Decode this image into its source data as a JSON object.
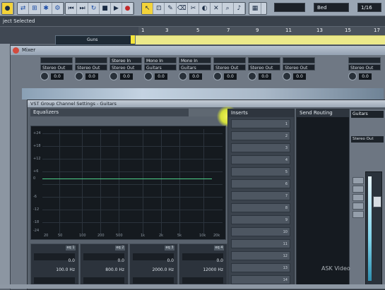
{
  "toolbar": {
    "fields": [
      "",
      "Bed",
      "1/16"
    ],
    "icons": [
      "arrow-icon",
      "range-icon",
      "pencil-icon",
      "eraser-icon",
      "scissors-icon",
      "glue-icon",
      "mute-icon",
      "zoom-icon",
      "line-icon",
      "play-icon",
      "speaker-icon",
      "color-icon"
    ]
  },
  "project": {
    "info_line": "ject Selected",
    "track_name": "Guns",
    "ruler": [
      "1",
      "3",
      "5",
      "7",
      "9",
      "11",
      "13",
      "15",
      "17"
    ]
  },
  "mixer": {
    "title": "Mixer",
    "strips": [
      {
        "name": "",
        "route": "Stereo Out",
        "value": "0.0"
      },
      {
        "name": "",
        "route": "Stereo Out",
        "value": "0.0"
      },
      {
        "name": "Stereo In",
        "route": "Stereo Out",
        "value": "0.0"
      },
      {
        "name": "Stereo In",
        "route": "Stereo Out",
        "value": "0.0"
      },
      {
        "name": "Mono In",
        "route": "Guitars",
        "value": "0.0"
      },
      {
        "name": "Mono In",
        "route": "Guitars",
        "value": "0.0"
      },
      {
        "name": "",
        "route": "Stereo Out",
        "value": "0.0"
      },
      {
        "name": "",
        "route": "Stereo Out",
        "value": "0.0"
      },
      {
        "name": "",
        "route": "Stereo Out",
        "value": "0.0"
      },
      {
        "name": "",
        "route": "Stereo Out",
        "value": "0.0"
      }
    ]
  },
  "channel_settings": {
    "title": "VST Group Channel Settings - Guitars",
    "equalizer_label": "Equalizers",
    "inserts_label": "Inserts",
    "send_routing_label": "Send Routing",
    "eq_y_ticks": [
      "+24",
      "+18",
      "+12",
      "+6",
      "0",
      "-6",
      "-12",
      "-18",
      "-24"
    ],
    "eq_x_ticks": [
      "20",
      "50",
      "100",
      "200",
      "500",
      "1k",
      "2k",
      "5k",
      "10k",
      "20k"
    ],
    "eq_bands": [
      {
        "on": "eq 1",
        "gain": "0.0",
        "freq": "100.0 Hz"
      },
      {
        "on": "eq 2",
        "gain": "0.0",
        "freq": "800.0 Hz"
      },
      {
        "on": "eq 3",
        "gain": "0.0",
        "freq": "2000.0 Hz"
      },
      {
        "on": "eq 4",
        "gain": "0.0",
        "freq": "12000 Hz"
      }
    ],
    "insert_slots": [
      "1",
      "2",
      "3",
      "4",
      "5",
      "6",
      "7",
      "8",
      "9",
      "10",
      "11",
      "12",
      "13",
      "14"
    ],
    "right_strip": {
      "name": "Guitars",
      "route": "Stereo Out",
      "value": "0.0"
    }
  },
  "watermark": "ASK Video"
}
